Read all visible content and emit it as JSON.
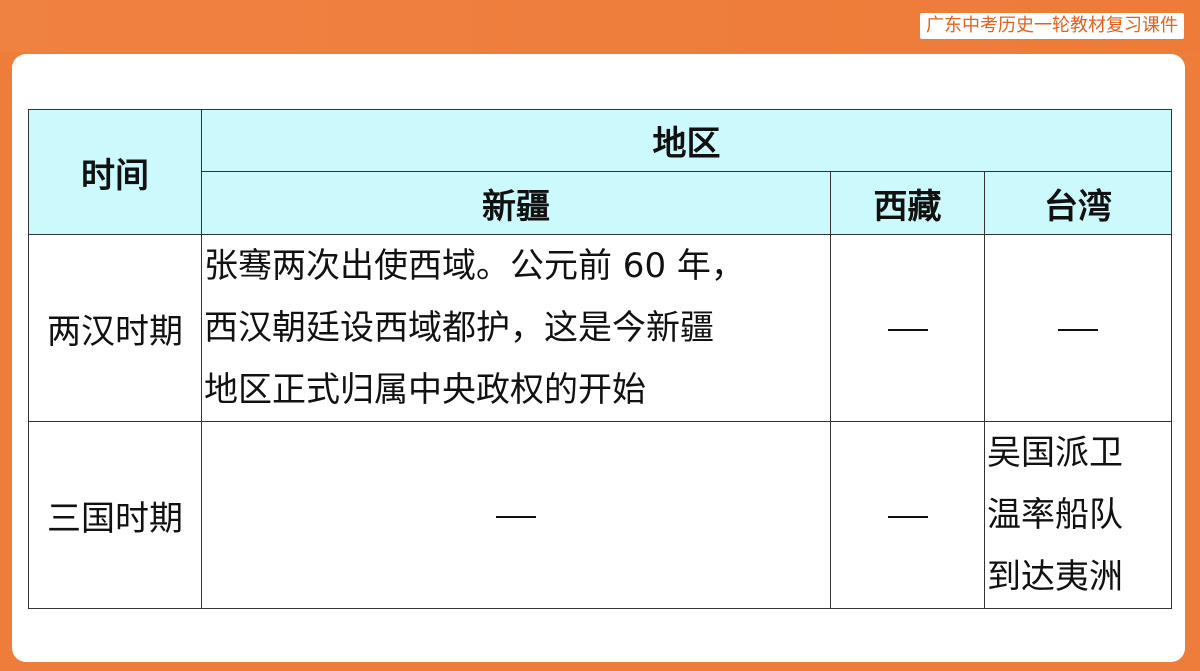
{
  "header": {
    "badge": "广东中考历史一轮教材复习课件"
  },
  "table": {
    "col_time": "时间",
    "col_region": "地区",
    "sub_xinjiang": "新疆",
    "sub_xizang": "西藏",
    "sub_taiwan": "台湾",
    "rows": [
      {
        "period": "两汉时期",
        "xinjiang_lines": [
          "张骞两次出使西域。公元前 60 年，",
          "西汉朝廷设西域都护，这是今新疆",
          "地区正式归属中央政权的开始"
        ],
        "xizang": "—",
        "taiwan": "—"
      },
      {
        "period": "三国时期",
        "xinjiang": "—",
        "xizang": "—",
        "taiwan_lines": [
          "吴国派卫",
          "温率船队",
          "到达夷洲"
        ]
      }
    ]
  }
}
